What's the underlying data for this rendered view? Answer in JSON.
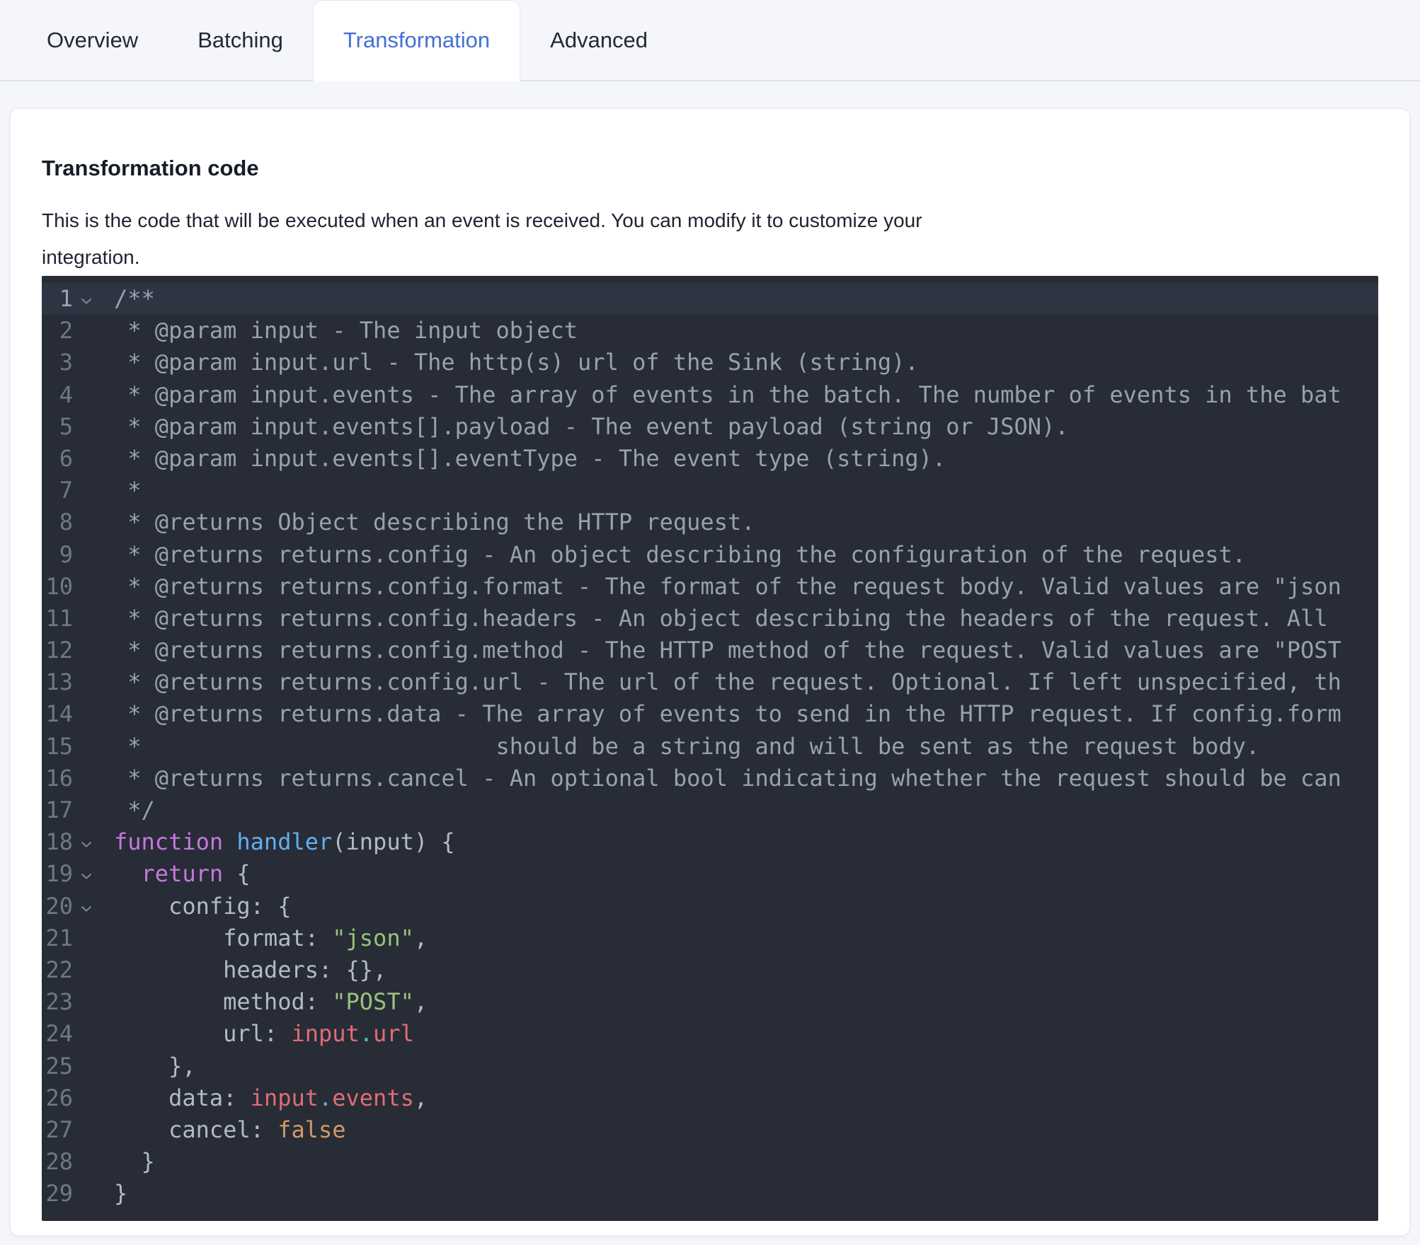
{
  "tabs": [
    {
      "label": "Overview",
      "active": false
    },
    {
      "label": "Batching",
      "active": false
    },
    {
      "label": "Transformation",
      "active": true
    },
    {
      "label": "Advanced",
      "active": false
    }
  ],
  "panel": {
    "title": "Transformation code",
    "description_lines": [
      "This is the code that will be executed when an event is received. You can modify it to customize your",
      "integration."
    ]
  },
  "colors": {
    "accent_tab_active": "#4270d5",
    "editor_background": "#272c36",
    "editor_active_line": "#2e3442",
    "line_number": "#6e7889",
    "comment": "#98a1b0",
    "plain": "#b3bac6",
    "keyword": "#c678dd",
    "function_name": "#61afef",
    "string": "#98c379",
    "variable": "#e06c75",
    "punct_dot": "#56b6c2",
    "boolean": "#d19a66"
  },
  "editor": {
    "lines": [
      {
        "n": 1,
        "fold": true,
        "active": true,
        "tokens": [
          {
            "c": "cm",
            "t": "/**"
          }
        ]
      },
      {
        "n": 2,
        "fold": false,
        "active": false,
        "tokens": [
          {
            "c": "cm",
            "t": " * @param input - The input object"
          }
        ]
      },
      {
        "n": 3,
        "fold": false,
        "active": false,
        "tokens": [
          {
            "c": "cm",
            "t": " * @param input.url - The http(s) url of the Sink (string)."
          }
        ]
      },
      {
        "n": 4,
        "fold": false,
        "active": false,
        "tokens": [
          {
            "c": "cm",
            "t": " * @param input.events - The array of events in the batch. The number of events in the bat"
          }
        ]
      },
      {
        "n": 5,
        "fold": false,
        "active": false,
        "tokens": [
          {
            "c": "cm",
            "t": " * @param input.events[].payload - The event payload (string or JSON)."
          }
        ]
      },
      {
        "n": 6,
        "fold": false,
        "active": false,
        "tokens": [
          {
            "c": "cm",
            "t": " * @param input.events[].eventType - The event type (string)."
          }
        ]
      },
      {
        "n": 7,
        "fold": false,
        "active": false,
        "tokens": [
          {
            "c": "cm",
            "t": " *"
          }
        ]
      },
      {
        "n": 8,
        "fold": false,
        "active": false,
        "tokens": [
          {
            "c": "cm",
            "t": " * @returns Object describing the HTTP request."
          }
        ]
      },
      {
        "n": 9,
        "fold": false,
        "active": false,
        "tokens": [
          {
            "c": "cm",
            "t": " * @returns returns.config - An object describing the configuration of the request."
          }
        ]
      },
      {
        "n": 10,
        "fold": false,
        "active": false,
        "tokens": [
          {
            "c": "cm",
            "t": " * @returns returns.config.format - The format of the request body. Valid values are \"json"
          }
        ]
      },
      {
        "n": 11,
        "fold": false,
        "active": false,
        "tokens": [
          {
            "c": "cm",
            "t": " * @returns returns.config.headers - An object describing the headers of the request. All"
          }
        ]
      },
      {
        "n": 12,
        "fold": false,
        "active": false,
        "tokens": [
          {
            "c": "cm",
            "t": " * @returns returns.config.method - The HTTP method of the request. Valid values are \"POST"
          }
        ]
      },
      {
        "n": 13,
        "fold": false,
        "active": false,
        "tokens": [
          {
            "c": "cm",
            "t": " * @returns returns.config.url - The url of the request. Optional. If left unspecified, th"
          }
        ]
      },
      {
        "n": 14,
        "fold": false,
        "active": false,
        "tokens": [
          {
            "c": "cm",
            "t": " * @returns returns.data - The array of events to send in the HTTP request. If config.form"
          }
        ]
      },
      {
        "n": 15,
        "fold": false,
        "active": false,
        "tokens": [
          {
            "c": "cm",
            "t": " *                          should be a string and will be sent as the request body."
          }
        ]
      },
      {
        "n": 16,
        "fold": false,
        "active": false,
        "tokens": [
          {
            "c": "cm",
            "t": " * @returns returns.cancel - An optional bool indicating whether the request should be can"
          }
        ]
      },
      {
        "n": 17,
        "fold": false,
        "active": false,
        "tokens": [
          {
            "c": "cm",
            "t": " */"
          }
        ]
      },
      {
        "n": 18,
        "fold": true,
        "active": false,
        "tokens": [
          {
            "c": "kw",
            "t": "function"
          },
          {
            "c": "pl",
            "t": " "
          },
          {
            "c": "fn",
            "t": "handler"
          },
          {
            "c": "pl",
            "t": "(input) {"
          }
        ]
      },
      {
        "n": 19,
        "fold": true,
        "active": false,
        "tokens": [
          {
            "c": "pl",
            "t": "  "
          },
          {
            "c": "kw",
            "t": "return"
          },
          {
            "c": "pl",
            "t": " {"
          }
        ]
      },
      {
        "n": 20,
        "fold": true,
        "active": false,
        "tokens": [
          {
            "c": "pl",
            "t": "    config: {"
          }
        ]
      },
      {
        "n": 21,
        "fold": false,
        "active": false,
        "tokens": [
          {
            "c": "pl",
            "t": "        format: "
          },
          {
            "c": "str",
            "t": "\"json\""
          },
          {
            "c": "pl",
            "t": ","
          }
        ]
      },
      {
        "n": 22,
        "fold": false,
        "active": false,
        "tokens": [
          {
            "c": "pl",
            "t": "        headers: {},"
          }
        ]
      },
      {
        "n": 23,
        "fold": false,
        "active": false,
        "tokens": [
          {
            "c": "pl",
            "t": "        method: "
          },
          {
            "c": "str",
            "t": "\"POST\""
          },
          {
            "c": "pl",
            "t": ","
          }
        ]
      },
      {
        "n": 24,
        "fold": false,
        "active": false,
        "tokens": [
          {
            "c": "pl",
            "t": "        url: "
          },
          {
            "c": "var",
            "t": "input"
          },
          {
            "c": "dot",
            "t": "."
          },
          {
            "c": "var",
            "t": "url"
          }
        ]
      },
      {
        "n": 25,
        "fold": false,
        "active": false,
        "tokens": [
          {
            "c": "pl",
            "t": "    },"
          }
        ]
      },
      {
        "n": 26,
        "fold": false,
        "active": false,
        "tokens": [
          {
            "c": "pl",
            "t": "    data: "
          },
          {
            "c": "var",
            "t": "input"
          },
          {
            "c": "dot",
            "t": "."
          },
          {
            "c": "var",
            "t": "events"
          },
          {
            "c": "pl",
            "t": ","
          }
        ]
      },
      {
        "n": 27,
        "fold": false,
        "active": false,
        "tokens": [
          {
            "c": "pl",
            "t": "    cancel: "
          },
          {
            "c": "bool",
            "t": "false"
          }
        ]
      },
      {
        "n": 28,
        "fold": false,
        "active": false,
        "tokens": [
          {
            "c": "pl",
            "t": "  }"
          }
        ]
      },
      {
        "n": 29,
        "fold": false,
        "active": false,
        "tokens": [
          {
            "c": "pl",
            "t": "}"
          }
        ]
      }
    ]
  }
}
